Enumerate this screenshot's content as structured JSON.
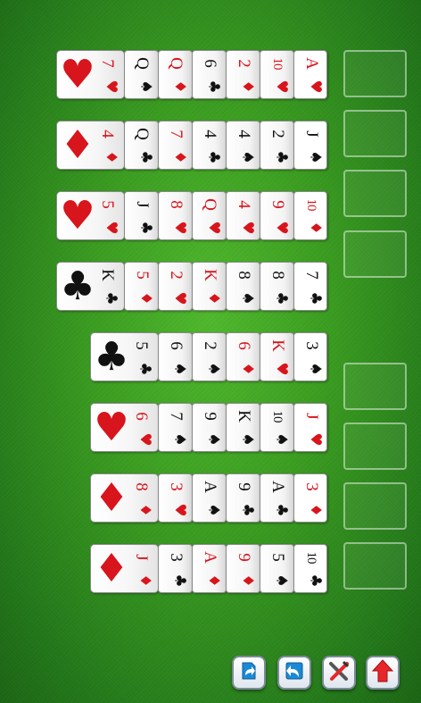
{
  "suit_glyphs": {
    "hearts": "♥",
    "diamonds": "♦",
    "clubs": "♣",
    "spades": "♠"
  },
  "rows": [
    {
      "base": "hearts",
      "cards": [
        {
          "rank": "7",
          "suit": "hearts"
        },
        {
          "rank": "Q",
          "suit": "spades"
        },
        {
          "rank": "Q",
          "suit": "diamonds"
        },
        {
          "rank": "6",
          "suit": "clubs"
        },
        {
          "rank": "2",
          "suit": "diamonds"
        },
        {
          "rank": "10",
          "suit": "hearts"
        },
        {
          "rank": "A",
          "suit": "hearts"
        }
      ]
    },
    {
      "base": "diamonds",
      "cards": [
        {
          "rank": "4",
          "suit": "diamonds"
        },
        {
          "rank": "Q",
          "suit": "clubs"
        },
        {
          "rank": "7",
          "suit": "diamonds"
        },
        {
          "rank": "4",
          "suit": "clubs"
        },
        {
          "rank": "4",
          "suit": "spades"
        },
        {
          "rank": "2",
          "suit": "clubs"
        },
        {
          "rank": "J",
          "suit": "spades"
        }
      ]
    },
    {
      "base": "hearts",
      "cards": [
        {
          "rank": "5",
          "suit": "hearts"
        },
        {
          "rank": "J",
          "suit": "clubs"
        },
        {
          "rank": "8",
          "suit": "hearts"
        },
        {
          "rank": "Q",
          "suit": "hearts"
        },
        {
          "rank": "4",
          "suit": "hearts"
        },
        {
          "rank": "9",
          "suit": "hearts"
        },
        {
          "rank": "10",
          "suit": "diamonds"
        }
      ]
    },
    {
      "base": "clubs",
      "cards": [
        {
          "rank": "K",
          "suit": "clubs"
        },
        {
          "rank": "5",
          "suit": "diamonds"
        },
        {
          "rank": "2",
          "suit": "hearts"
        },
        {
          "rank": "K",
          "suit": "diamonds"
        },
        {
          "rank": "8",
          "suit": "spades"
        },
        {
          "rank": "8",
          "suit": "clubs"
        },
        {
          "rank": "7",
          "suit": "clubs"
        }
      ]
    },
    {
      "base": "clubs",
      "cards": [
        {
          "rank": "5",
          "suit": "clubs"
        },
        {
          "rank": "6",
          "suit": "spades"
        },
        {
          "rank": "2",
          "suit": "spades"
        },
        {
          "rank": "6",
          "suit": "diamonds"
        },
        {
          "rank": "K",
          "suit": "hearts"
        },
        {
          "rank": "3",
          "suit": "spades"
        }
      ]
    },
    {
      "base": "hearts",
      "cards": [
        {
          "rank": "6",
          "suit": "hearts"
        },
        {
          "rank": "7",
          "suit": "spades"
        },
        {
          "rank": "9",
          "suit": "spades"
        },
        {
          "rank": "K",
          "suit": "spades"
        },
        {
          "rank": "10",
          "suit": "spades"
        },
        {
          "rank": "J",
          "suit": "hearts"
        }
      ]
    },
    {
      "base": "diamonds",
      "cards": [
        {
          "rank": "8",
          "suit": "diamonds"
        },
        {
          "rank": "3",
          "suit": "hearts"
        },
        {
          "rank": "A",
          "suit": "spades"
        },
        {
          "rank": "9",
          "suit": "clubs"
        },
        {
          "rank": "A",
          "suit": "clubs"
        },
        {
          "rank": "3",
          "suit": "diamonds"
        }
      ]
    },
    {
      "base": "diamonds",
      "cards": [
        {
          "rank": "J",
          "suit": "diamonds"
        },
        {
          "rank": "3",
          "suit": "clubs"
        },
        {
          "rank": "A",
          "suit": "diamonds"
        },
        {
          "rank": "9",
          "suit": "diamonds"
        },
        {
          "rank": "5",
          "suit": "spades"
        },
        {
          "rank": "10",
          "suit": "clubs"
        }
      ]
    }
  ],
  "free_slots": 8,
  "toolbar": [
    {
      "name": "restart-button",
      "icon": "redo-deal-icon"
    },
    {
      "name": "undo-button",
      "icon": "undo-arrow-icon"
    },
    {
      "name": "settings-button",
      "icon": "tools-icon"
    },
    {
      "name": "auto-move-button",
      "icon": "up-arrow-icon"
    }
  ],
  "colors": {
    "felt": "#3a9c20",
    "red_suit": "#d8141c",
    "black_suit": "#111111",
    "button_icon": "#1b8ad6",
    "up_arrow": "#e8262a"
  }
}
